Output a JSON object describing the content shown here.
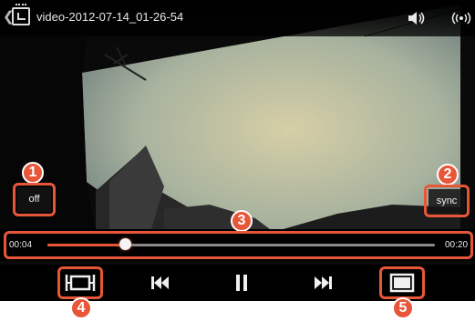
{
  "header": {
    "title": "video-2012-07-14_01-26-54",
    "icons": [
      "back-chevron-icon",
      "video-app-icon",
      "volume-icon",
      "cast-icon"
    ]
  },
  "subtitle_button": {
    "label": "off"
  },
  "sync_button": {
    "label": "sync"
  },
  "seek": {
    "elapsed": "00:04",
    "duration": "00:20",
    "progress": 0.2
  },
  "controls": {
    "icons": [
      "aspect-ratio-icon",
      "previous-icon",
      "pause-icon",
      "next-icon",
      "screen-mode-icon"
    ]
  },
  "callouts": {
    "c1": "1",
    "c2": "2",
    "c3": "3",
    "c4": "4",
    "c5": "5"
  },
  "colors": {
    "accent": "#e8563a",
    "bar": "#000000",
    "text": "#e8e8e8"
  }
}
